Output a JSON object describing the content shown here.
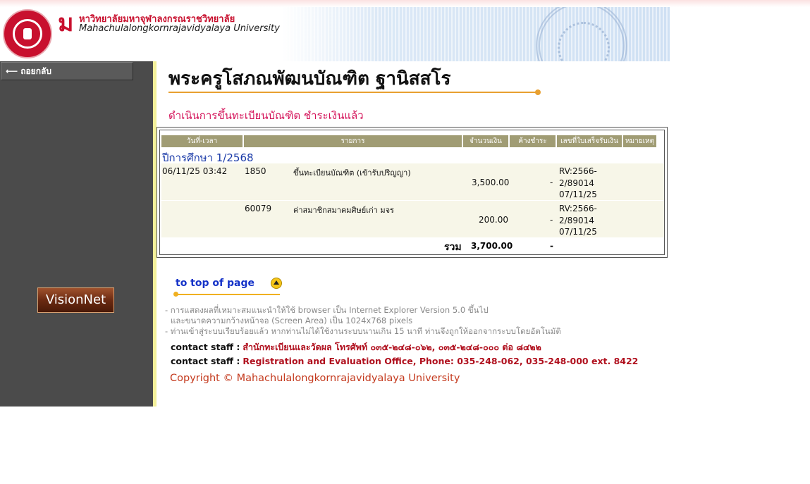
{
  "header": {
    "university_th": "หาวิทยาลัยมหาจุฬาลงกรณราชวิทยาลัย",
    "university_en": "Mahachulalongkornrajavidyalaya University",
    "mark_letter": "ม"
  },
  "sidebar": {
    "back_label": "ถอยกลับ",
    "vision_label": "VisionNet"
  },
  "main": {
    "name": "พระครูโสภณพัฒนบัณฑิต ฐานิสสโร",
    "status": "ดำเนินการขึ้นทะเบียนบัณฑิต ชำระเงินแล้ว"
  },
  "table": {
    "headers": [
      "วันที่-เวลา",
      "รายการ",
      "จำนวนเงิน",
      "ค้างชำระ",
      "เลขที่ใบเสร็จรับเงิน",
      "หมายเหตุ"
    ],
    "year_label": "ปีการศึกษา 1/2568",
    "rows": [
      {
        "datetime": "06/11/25 03:42",
        "code": "1850",
        "item": "ขึ้นทะเบียนบัณฑิต (เข้ารับปริญญา)",
        "amount": "3,500.00",
        "due": "-",
        "receipt_1": "RV:2566-",
        "receipt_2": "2/89014",
        "receipt_3": "07/11/25"
      },
      {
        "datetime": "",
        "code": "60079",
        "item": "ค่าสมาชิกสมาคมศิษย์เก่า มจร",
        "amount": "200.00",
        "due": "-",
        "receipt_1": "RV:2566-",
        "receipt_2": "2/89014",
        "receipt_3": "07/11/25"
      }
    ],
    "total_label": "รวม",
    "total_amount": "3,700.00",
    "total_due": "-"
  },
  "footer": {
    "to_top": "to top of page",
    "note1": "- การแสดงผลที่เหมาะสมแนะนำให้ใช้ browser เป็น Internet Explorer Version 5.0 ขึ้นไป",
    "note2": "และขนาดความกว้างหน้าจอ (Screen Area) เป็น 1024x768 pixels",
    "note3": "- ท่านเข้าสู่ระบบเรียบร้อยแล้ว หากท่านไม่ได้ใช้งานระบบนานเกิน 15 นาที ท่านจึงถูกให้ออกจากระบบโดยอัตโนมัติ",
    "contact_key": "contact staff :",
    "contact_th": "สำนักทะเบียนและวัดผล โทรศัพท์ ๐๓๕-๒๔๘-๐๖๒, ๐๓๕-๒๔๘-๐๐๐ ต่อ ๘๔๒๒",
    "contact_en": "Registration and Evaluation Office, Phone: 035-248-062, 035-248-000 ext. 8422",
    "copyright": "Copyright © Mahachulalongkornrajavidyalaya University"
  }
}
